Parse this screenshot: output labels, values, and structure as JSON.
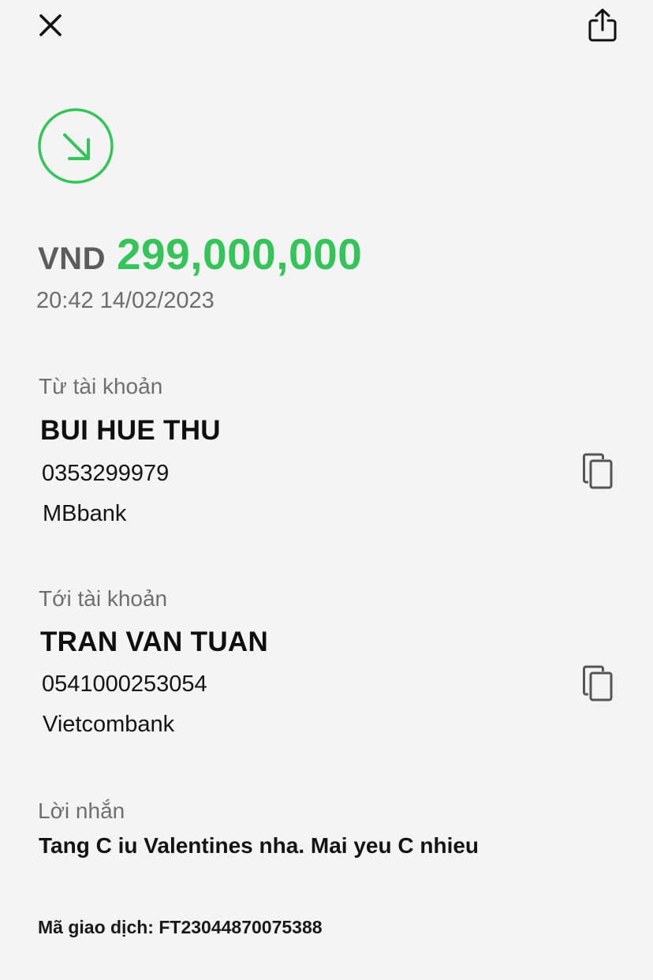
{
  "header": {
    "close_icon": "close-icon",
    "share_icon": "share-icon"
  },
  "status": {
    "icon": "incoming-arrow-icon",
    "color": "#35c45a"
  },
  "transaction": {
    "currency": "VND",
    "amount": "299,000,000",
    "datetime": "20:42 14/02/2023"
  },
  "from": {
    "label": "Từ tài khoản",
    "name": "BUI HUE THU",
    "account_number": "0353299979",
    "bank": "MBbank"
  },
  "to": {
    "label": "Tới tài khoản",
    "name": "TRAN VAN TUAN",
    "account_number": "0541000253054",
    "bank": "Vietcombank"
  },
  "message": {
    "label": "Lời nhắn",
    "text": "Tang C iu Valentines nha. Mai yeu C nhieu"
  },
  "reference": {
    "label": "Mã giao dịch:",
    "code": "FT23044870075388"
  },
  "colors": {
    "background": "#f4f4f4",
    "accent_green": "#35c45a",
    "muted_text": "#6f6f6f"
  }
}
